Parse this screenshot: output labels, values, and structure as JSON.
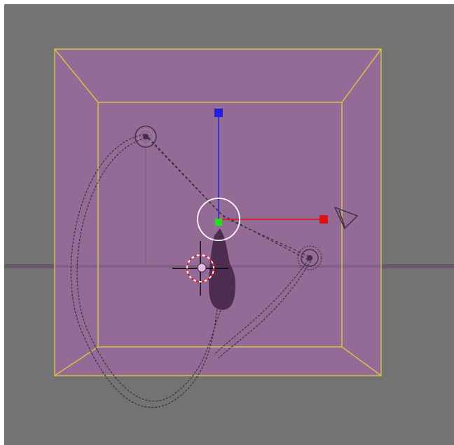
{
  "viewport": {
    "background": "#737373",
    "room_fill": "#946b96",
    "room_edge_color": "#d4c24a",
    "gizmo_x_color": "#e01010",
    "gizmo_y_color": "#2020e0",
    "gizmo_center_color": "#20e020",
    "curve_color": "#3a2f3a",
    "object_color": "#4e2c50"
  },
  "icons": [
    "3d-cursor-icon",
    "camera-icon",
    "empty-target-icon",
    "transform-gizmo-icon"
  ]
}
